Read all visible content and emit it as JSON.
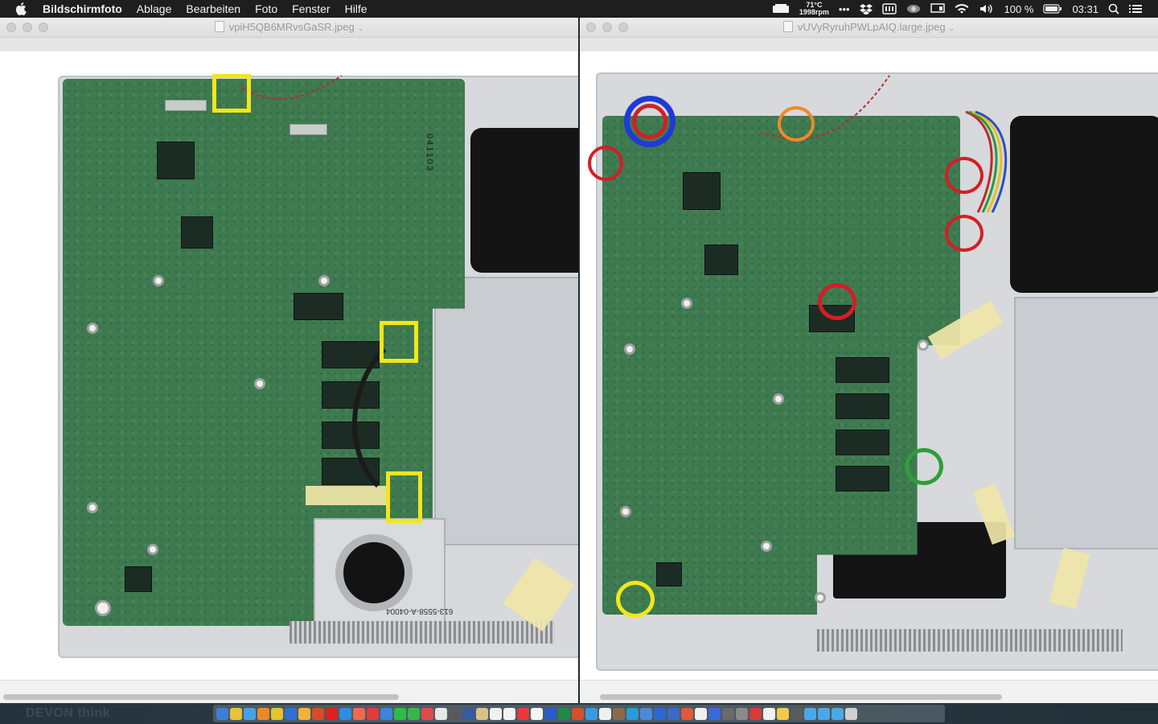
{
  "menubar": {
    "app_name": "Bildschirmfoto",
    "menus": [
      "Ablage",
      "Bearbeiten",
      "Foto",
      "Fenster",
      "Hilfe"
    ],
    "status": {
      "temp": "71°C",
      "rpm": "1998rpm",
      "battery_pct": "100 %",
      "time": "03:31"
    }
  },
  "windows": {
    "left": {
      "title": "vpiH5QB6MRvsGaSR.jpeg"
    },
    "right": {
      "title": "vUVyRyruhPWLpAIQ.large.jpeg"
    }
  },
  "board_labels": {
    "left_fan_part": "613-5558-A-04004",
    "left_chip_code": "041103"
  },
  "dock": {
    "wallpaper_text": "DEVON think"
  },
  "colors": {
    "menubar": "#1e1e1e",
    "highlight_yellow": "#f2e61c",
    "ring_blue": "#1f3bd6",
    "ring_red": "#d41e25",
    "ring_orange": "#f08a24",
    "ring_green": "#2f9e3a",
    "pcb_green": "#3e7a4f"
  }
}
